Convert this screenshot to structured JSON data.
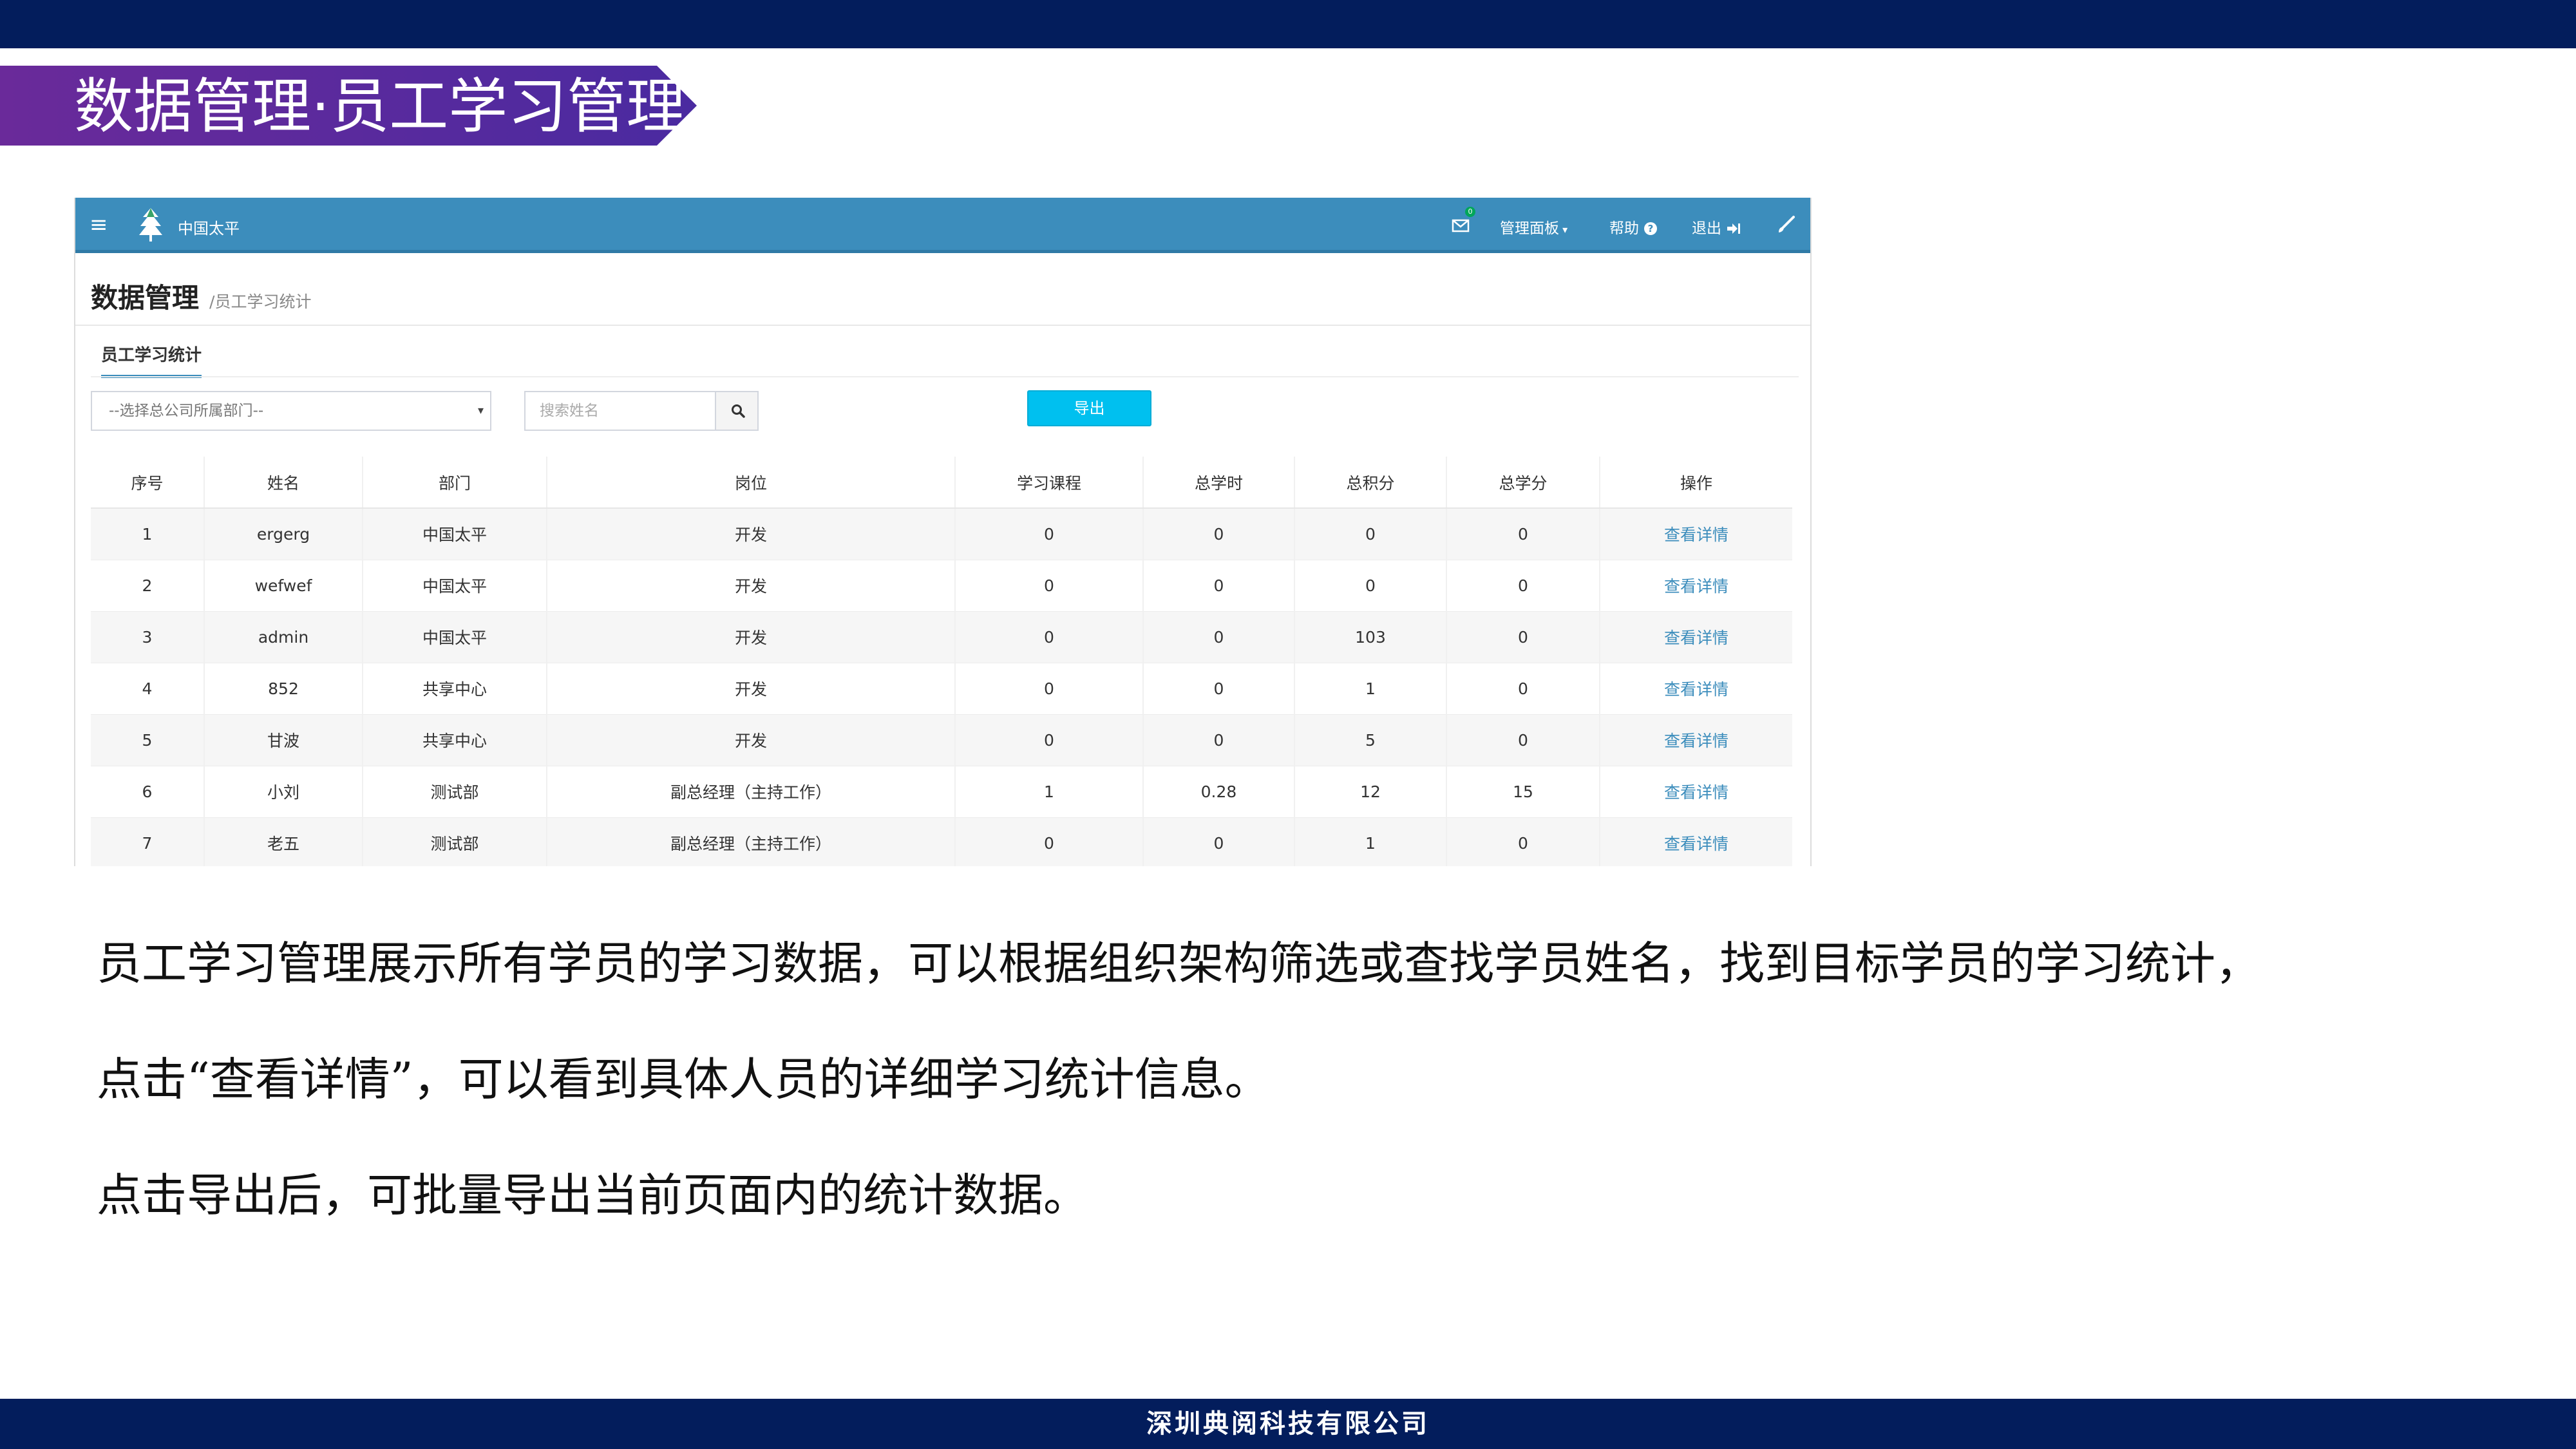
{
  "slide": {
    "title": "数据管理·员工学习管理",
    "footer": "深圳典阅科技有限公司",
    "colors": {
      "top_bar": "#031d5c",
      "ribbon_start": "#6a2a9a",
      "ribbon_end": "#4a2aa0",
      "nav_bar": "#3c8dbc",
      "export_button": "#00c0ef",
      "link": "#3c8dbc"
    }
  },
  "app": {
    "navbar": {
      "menu_icon": "hamburger-icon",
      "logo_icon": "tree-logo-icon",
      "brand": "中国太平",
      "mail_badge": "0",
      "items": {
        "panel": "管理面板",
        "help": "帮助",
        "logout": "退出"
      },
      "icons": {
        "mail": "mail-icon",
        "help": "question-circle-icon",
        "logout": "sign-out-icon",
        "brush": "brush-icon"
      }
    },
    "page_header": {
      "title": "数据管理",
      "breadcrumb": "/员工学习统计"
    },
    "tab_label": "员工学习统计",
    "filters": {
      "dept_select_value": "--选择总公司所属部门--",
      "search_placeholder": "搜索姓名",
      "export_label": "导出"
    },
    "table": {
      "headers": {
        "index": "序号",
        "name": "姓名",
        "dept": "部门",
        "position": "岗位",
        "courses": "学习课程",
        "hours": "总学时",
        "points": "总积分",
        "credits": "总学分",
        "action": "操作"
      },
      "rows": [
        {
          "index": "1",
          "name": "ergerg",
          "dept": "中国太平",
          "position": "开发",
          "courses": "0",
          "hours": "0",
          "points": "0",
          "credits": "0",
          "action": "查看详情"
        },
        {
          "index": "2",
          "name": "wefwef",
          "dept": "中国太平",
          "position": "开发",
          "courses": "0",
          "hours": "0",
          "points": "0",
          "credits": "0",
          "action": "查看详情"
        },
        {
          "index": "3",
          "name": "admin",
          "dept": "中国太平",
          "position": "开发",
          "courses": "0",
          "hours": "0",
          "points": "103",
          "credits": "0",
          "action": "查看详情"
        },
        {
          "index": "4",
          "name": "852",
          "dept": "共享中心",
          "position": "开发",
          "courses": "0",
          "hours": "0",
          "points": "1",
          "credits": "0",
          "action": "查看详情"
        },
        {
          "index": "5",
          "name": "甘波",
          "dept": "共享中心",
          "position": "开发",
          "courses": "0",
          "hours": "0",
          "points": "5",
          "credits": "0",
          "action": "查看详情"
        },
        {
          "index": "6",
          "name": "小刘",
          "dept": "测试部",
          "position": "副总经理（主持工作）",
          "courses": "1",
          "hours": "0.28",
          "points": "12",
          "credits": "15",
          "action": "查看详情"
        },
        {
          "index": "7",
          "name": "老五",
          "dept": "测试部",
          "position": "副总经理（主持工作）",
          "courses": "0",
          "hours": "0",
          "points": "1",
          "credits": "0",
          "action": "查看详情"
        }
      ]
    }
  },
  "description": {
    "line1": "员工学习管理展示所有学员的学习数据，可以根据组织架构筛选或查找学员姓名，找到目标学员的学习统计，",
    "line2": "点击“查看详情”，可以看到具体人员的详细学习统计信息。",
    "line3": "点击导出后，可批量导出当前页面内的统计数据。"
  }
}
